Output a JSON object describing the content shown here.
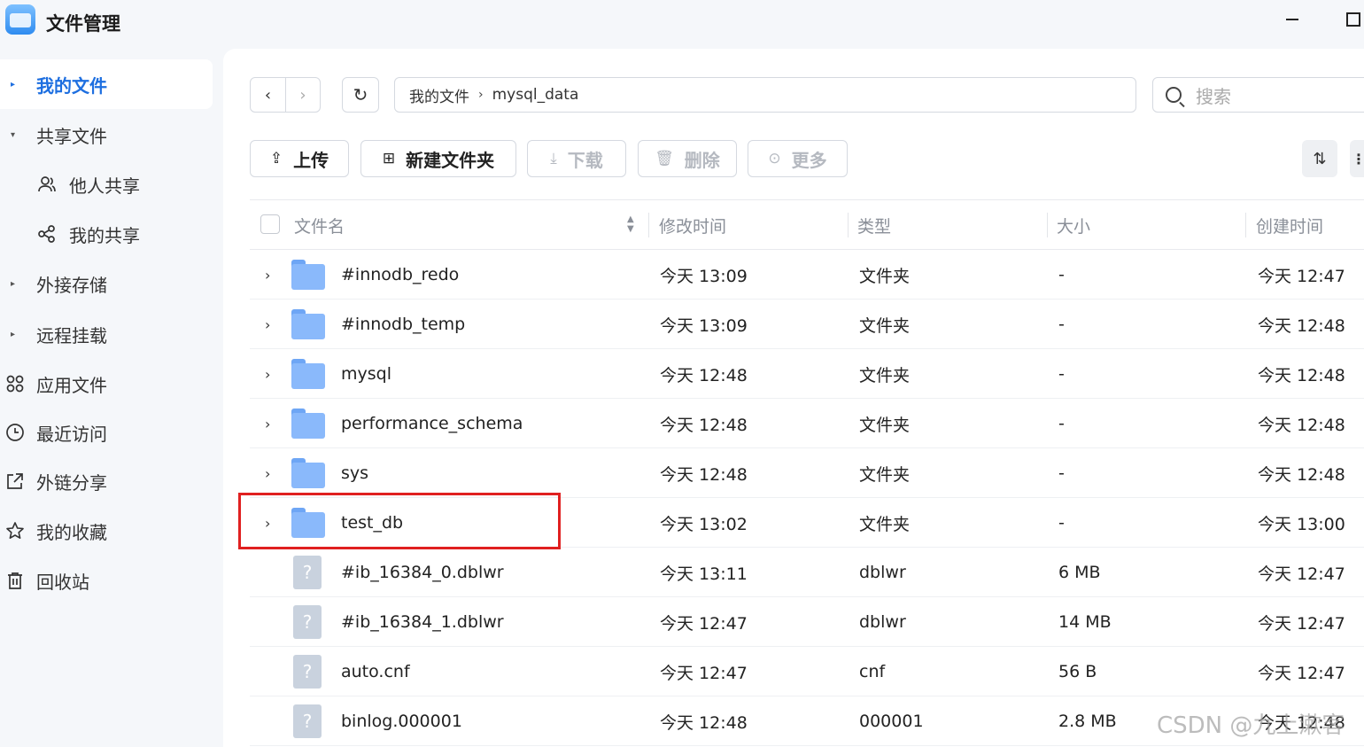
{
  "app": {
    "title": "文件管理"
  },
  "sidebar": {
    "items": [
      {
        "label": "我的文件",
        "caret": "▸",
        "icon": ""
      },
      {
        "label": "共享文件",
        "caret": "▾",
        "icon": ""
      },
      {
        "label": "他人共享",
        "caret": "",
        "icon": "people-icon"
      },
      {
        "label": "我的共享",
        "caret": "",
        "icon": "share-icon"
      },
      {
        "label": "外接存储",
        "caret": "▸",
        "icon": ""
      },
      {
        "label": "远程挂载",
        "caret": "▸",
        "icon": ""
      },
      {
        "label": "应用文件",
        "caret": "",
        "icon": "apps-icon"
      },
      {
        "label": "最近访问",
        "caret": "",
        "icon": "clock-icon"
      },
      {
        "label": "外链分享",
        "caret": "",
        "icon": "external-link-icon"
      },
      {
        "label": "我的收藏",
        "caret": "",
        "icon": "star-icon"
      },
      {
        "label": "回收站",
        "caret": "",
        "icon": "trash-icon"
      }
    ]
  },
  "nav": {
    "back": "‹",
    "forward": "›",
    "refresh": "↻",
    "breadcrumb": [
      "我的文件",
      "mysql_data"
    ],
    "crumb_sep": "›",
    "search_placeholder": "搜索"
  },
  "toolbar": {
    "upload": "上传",
    "new_folder": "新建文件夹",
    "download": "下载",
    "delete": "删除",
    "more": "更多",
    "upload_icon": "⇪",
    "new_folder_icon": "⊞",
    "download_icon": "⤓",
    "delete_icon": "🗑",
    "more_icon": "⊙",
    "sort_icon": "⇅",
    "overflow_icon": "⋮"
  },
  "table": {
    "columns": [
      "文件名",
      "修改时间",
      "类型",
      "大小",
      "创建时间"
    ],
    "rows": [
      {
        "kind": "folder",
        "name": "#innodb_redo",
        "modified": "今天 13:09",
        "type": "文件夹",
        "size": "-",
        "created": "今天 12:47"
      },
      {
        "kind": "folder",
        "name": "#innodb_temp",
        "modified": "今天 13:09",
        "type": "文件夹",
        "size": "-",
        "created": "今天 12:48"
      },
      {
        "kind": "folder",
        "name": "mysql",
        "modified": "今天 12:48",
        "type": "文件夹",
        "size": "-",
        "created": "今天 12:48"
      },
      {
        "kind": "folder",
        "name": "performance_schema",
        "modified": "今天 12:48",
        "type": "文件夹",
        "size": "-",
        "created": "今天 12:48"
      },
      {
        "kind": "folder",
        "name": "sys",
        "modified": "今天 12:48",
        "type": "文件夹",
        "size": "-",
        "created": "今天 12:48"
      },
      {
        "kind": "folder",
        "name": "test_db",
        "modified": "今天 13:02",
        "type": "文件夹",
        "size": "-",
        "created": "今天 13:00"
      },
      {
        "kind": "file",
        "name": "#ib_16384_0.dblwr",
        "modified": "今天 13:11",
        "type": "dblwr",
        "size": "6 MB",
        "created": "今天 12:47"
      },
      {
        "kind": "file",
        "name": "#ib_16384_1.dblwr",
        "modified": "今天 12:47",
        "type": "dblwr",
        "size": "14 MB",
        "created": "今天 12:47"
      },
      {
        "kind": "file",
        "name": "auto.cnf",
        "modified": "今天 12:47",
        "type": "cnf",
        "size": "56 B",
        "created": "今天 12:47"
      },
      {
        "kind": "file",
        "name": "binlog.000001",
        "modified": "今天 12:48",
        "type": "000001",
        "size": "2.8 MB",
        "created": "今天 12:48"
      }
    ]
  },
  "watermark": "CSDN @九上漱客",
  "colors": {
    "accent": "#1e6fe0",
    "highlight": "#e02020",
    "folder": "#8ab9fb"
  }
}
